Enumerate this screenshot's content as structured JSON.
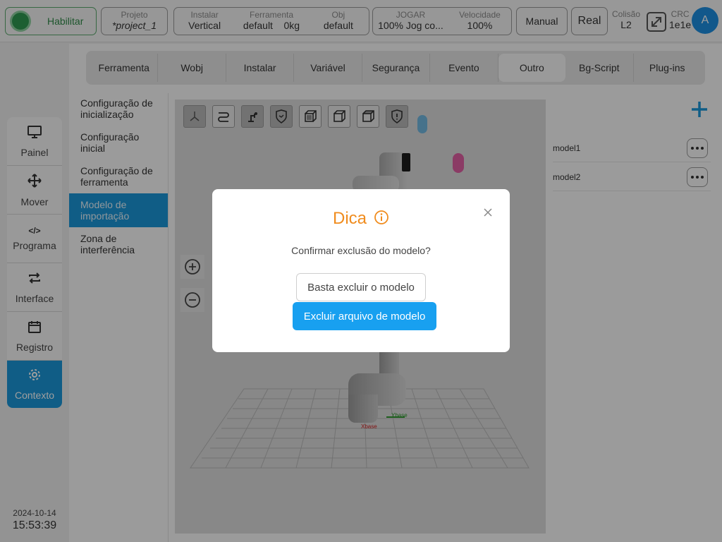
{
  "topbar": {
    "enable_label": "Habilitar",
    "project": {
      "label": "Projeto",
      "value": "*project_1"
    },
    "install": {
      "label": "Instalar",
      "value": "Vertical"
    },
    "tool": {
      "label": "Ferramenta",
      "value": "default    0kg"
    },
    "obj": {
      "label": "Obj",
      "value": "default"
    },
    "jog": {
      "label": "JOGAR",
      "value": "100%  Jog co..."
    },
    "speed": {
      "label": "Velocidade",
      "value": "100%"
    },
    "manual_label": "Manual",
    "real_label": "Real",
    "collision": {
      "label": "Colisão",
      "value": "L2"
    },
    "crc": {
      "label": "CRC",
      "value": "1e1e"
    },
    "avatar_letter": "A"
  },
  "leftnav": {
    "items": [
      {
        "label": "Painel",
        "icon": "monitor-icon"
      },
      {
        "label": "Mover",
        "icon": "move-icon"
      },
      {
        "label": "Programa",
        "icon": "code-icon"
      },
      {
        "label": "Interface",
        "icon": "swap-icon"
      },
      {
        "label": "Registro",
        "icon": "calendar-icon"
      },
      {
        "label": "Contexto",
        "icon": "gear-icon"
      }
    ],
    "active_index": 5,
    "date": "2024-10-14",
    "time": "15:53:39"
  },
  "tabs": [
    "Ferramenta",
    "Wobj",
    "Instalar",
    "Variável",
    "Segurança",
    "Evento",
    "Outro",
    "Bg-Script",
    "Plug-ins"
  ],
  "active_tab": "Outro",
  "submenu": [
    "Configuração de inicialização",
    "Configuração inicial",
    "Configuração de ferramenta",
    "Modelo de importação",
    "Zona de interferência"
  ],
  "active_submenu": "Modelo de importação",
  "models": [
    "model1",
    "model2"
  ],
  "axis_labels": {
    "x": "Xbase",
    "y": "Ybase"
  },
  "dialog": {
    "title": "Dica",
    "message": "Confirmar exclusão do modelo?",
    "btn_secondary": "Basta excluir o modelo",
    "btn_primary": "Excluir arquivo de modelo"
  },
  "colors": {
    "accent": "#1a96d8",
    "primary_button": "#18a0f0",
    "dialog_title": "#f08c1e",
    "enable_green": "#2f9a52"
  }
}
